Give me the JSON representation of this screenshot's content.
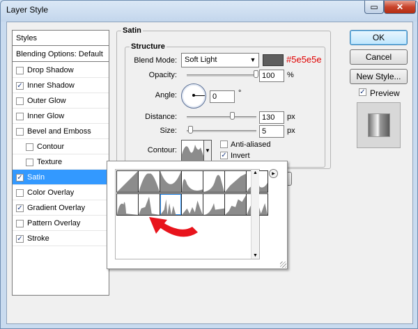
{
  "window": {
    "title": "Layer Style",
    "minimize_glyph": "▭",
    "close_glyph": "✕"
  },
  "styles_panel": {
    "header": "Styles",
    "blending": "Blending Options: Default",
    "items": [
      {
        "label": "Drop Shadow",
        "checked": false,
        "indent": false,
        "selected": false
      },
      {
        "label": "Inner Shadow",
        "checked": true,
        "indent": false,
        "selected": false
      },
      {
        "label": "Outer Glow",
        "checked": false,
        "indent": false,
        "selected": false
      },
      {
        "label": "Inner Glow",
        "checked": false,
        "indent": false,
        "selected": false
      },
      {
        "label": "Bevel and Emboss",
        "checked": false,
        "indent": false,
        "selected": false
      },
      {
        "label": "Contour",
        "checked": false,
        "indent": true,
        "selected": false
      },
      {
        "label": "Texture",
        "checked": false,
        "indent": true,
        "selected": false
      },
      {
        "label": "Satin",
        "checked": true,
        "indent": false,
        "selected": true
      },
      {
        "label": "Color Overlay",
        "checked": false,
        "indent": false,
        "selected": false
      },
      {
        "label": "Gradient Overlay",
        "checked": true,
        "indent": false,
        "selected": false
      },
      {
        "label": "Pattern Overlay",
        "checked": false,
        "indent": false,
        "selected": false
      },
      {
        "label": "Stroke",
        "checked": true,
        "indent": false,
        "selected": false
      }
    ]
  },
  "satin": {
    "group_title": "Satin",
    "structure_title": "Structure",
    "blend_mode_label": "Blend Mode:",
    "blend_mode_value": "Soft Light",
    "color_annotation": "#5e5e5e",
    "swatch_color": "#5e5e5e",
    "opacity_label": "Opacity:",
    "opacity_value": "100",
    "opacity_unit": "%",
    "opacity_level": 1.0,
    "angle_label": "Angle:",
    "angle_value": "0",
    "angle_unit": "°",
    "distance_label": "Distance:",
    "distance_value": "130",
    "distance_unit": "px",
    "distance_level": 0.65,
    "size_label": "Size:",
    "size_value": "5",
    "size_unit": "px",
    "size_level": 0.02,
    "contour_label": "Contour:",
    "anti_aliased_label": "Anti-aliased",
    "anti_aliased_checked": false,
    "invert_label": "Invert",
    "invert_checked": true
  },
  "buttons": {
    "ok": "OK",
    "cancel": "Cancel",
    "new_style": "New Style...",
    "preview_label": "Preview",
    "preview_checked": true
  },
  "contour_picker": {
    "menu_glyph": "▸",
    "presets": 14,
    "highlighted_preset": 9
  },
  "colors": {
    "annotation": "#e00000",
    "arrow": "#e8141c",
    "selection": "#3399ff",
    "contour_fill": "#8c8c8c"
  }
}
